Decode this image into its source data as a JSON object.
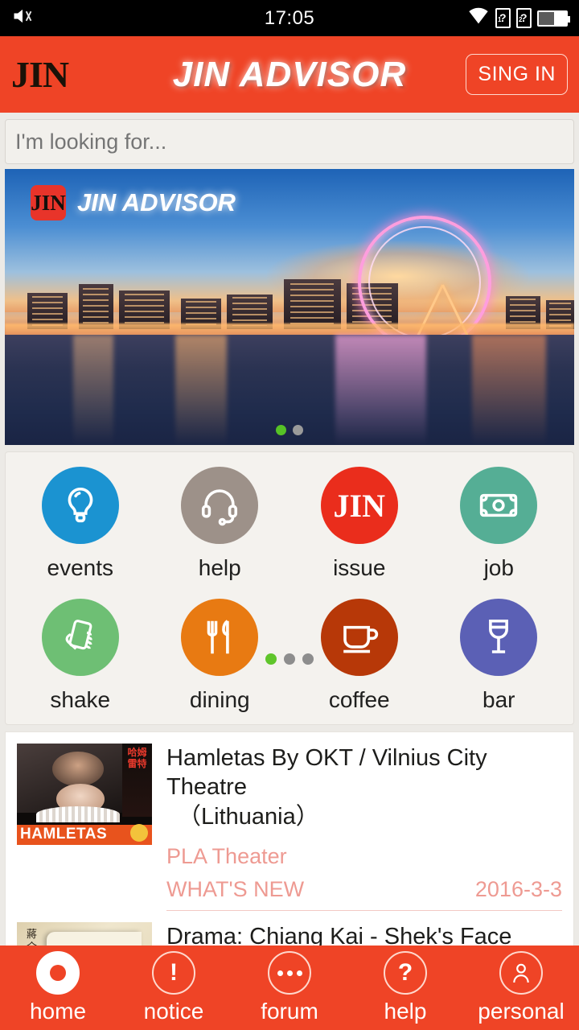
{
  "statusbar": {
    "time": "17:05",
    "mute_icon": "mute-icon",
    "wifi_icon": "wifi-icon",
    "sim1": "1",
    "sim2": "2",
    "sim_glyph": "?",
    "battery_icon": "battery-icon"
  },
  "header": {
    "logo": "JIN",
    "title": "JIN ADVISOR",
    "signin_label": "SING IN",
    "bg_color": "#ef4426"
  },
  "search": {
    "placeholder": "I'm looking for...",
    "value": ""
  },
  "banner": {
    "badge": "JIN",
    "name": "JIN ADVISOR",
    "alt": "Tianjin Eye ferris wheel city skyline at dusk reflected in river",
    "dots": [
      "active",
      "inactive"
    ]
  },
  "grid": {
    "row1": [
      {
        "label": "events",
        "icon": "lightbulb-icon",
        "color": "#1b93d1"
      },
      {
        "label": "help",
        "icon": "headset-icon",
        "color": "#9d9189"
      },
      {
        "label": "issue",
        "icon": "jin-logo-icon",
        "color": "#ea2d1c"
      },
      {
        "label": "job",
        "icon": "banknote-icon",
        "color": "#55ae95"
      }
    ],
    "row2": [
      {
        "label": "shake",
        "icon": "hand-phone-icon",
        "color": "#6ebf74"
      },
      {
        "label": "dining",
        "icon": "fork-knife-icon",
        "color": "#e87a12"
      },
      {
        "label": "coffee",
        "icon": "coffee-cup-icon",
        "color": "#b73808"
      },
      {
        "label": "bar",
        "icon": "wine-glass-icon",
        "color": "#5b60b5"
      }
    ],
    "page_dots": [
      "active",
      "inactive",
      "inactive"
    ]
  },
  "list": {
    "items": [
      {
        "title_line1": "Hamletas By OKT / Vilnius City Theatre",
        "title_line2": "（Lithuania）",
        "venue": "PLA Theater",
        "tag": "WHAT'S NEW",
        "date": "2016-3-3",
        "thumb_cn": "哈姆雷特",
        "thumb_band": "HAMLETAS",
        "accent_color": "#ee9a92"
      },
      {
        "title_line1": "Drama: Chiang Kai - Shek's Face",
        "thumb_cn": "蔣介石的面",
        "thumb_big": "蔣"
      }
    ]
  },
  "nav": {
    "items": [
      {
        "label": "home",
        "icon": "home-dot-icon",
        "active": true
      },
      {
        "label": "notice",
        "icon": "exclamation-icon",
        "active": false
      },
      {
        "label": "forum",
        "icon": "ellipsis-icon",
        "active": false
      },
      {
        "label": "help",
        "icon": "question-icon",
        "active": false
      },
      {
        "label": "personal",
        "icon": "person-icon",
        "active": false
      }
    ]
  }
}
